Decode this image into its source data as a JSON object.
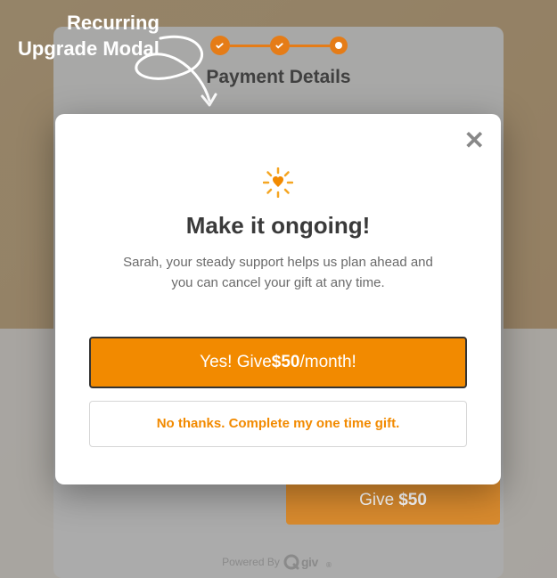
{
  "annotation": {
    "line1": "Recurring",
    "line2": "Upgrade Modal"
  },
  "stepper": {
    "title": "Payment Details"
  },
  "modal": {
    "title": "Make it ongoing!",
    "subtitle": "Sarah, your steady support helps us plan ahead and you can cancel your gift at any time.",
    "yes_prefix": "Yes! Give ",
    "yes_amount": "$50",
    "yes_suffix": "/month!",
    "no_label": "No thanks. Complete my one time gift."
  },
  "background": {
    "give_prefix": "Give ",
    "give_amount": "$50",
    "powered_by": "Powered By",
    "brand": "Qgiv"
  },
  "colors": {
    "accent": "#f28a00"
  }
}
